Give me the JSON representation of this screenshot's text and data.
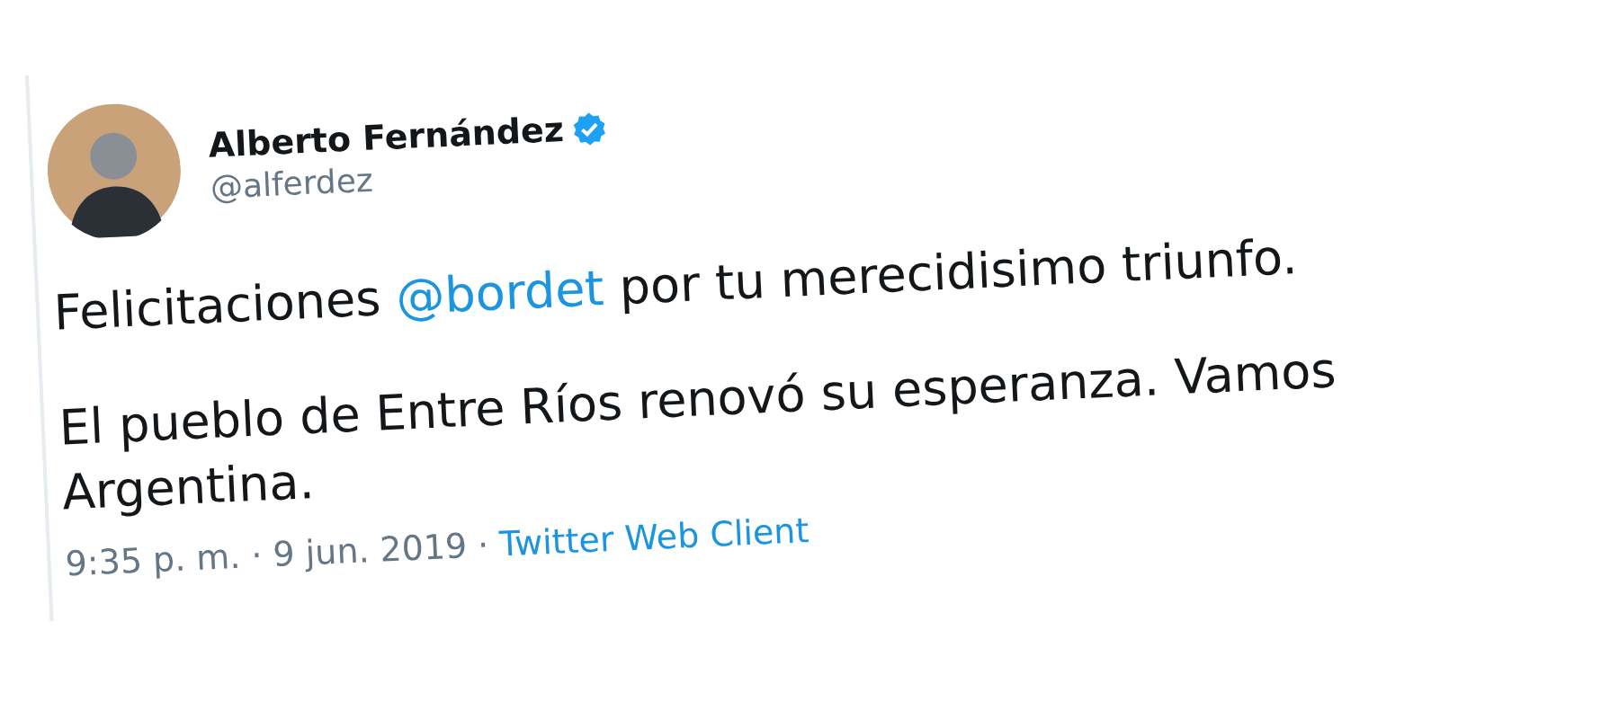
{
  "tweet": {
    "author": {
      "name": "Alberto Fernández",
      "verified": true,
      "handle": "@alferdez"
    },
    "paragraphs": [
      [
        {
          "kind": "text",
          "text": "Felicitaciones "
        },
        {
          "kind": "mention",
          "text": "@bordet"
        },
        {
          "kind": "text",
          "text": " por tu merecidisimo triunfo."
        }
      ],
      [
        {
          "kind": "text",
          "text": "El pueblo de Entre Ríos renovó su esperanza. Vamos Argentina."
        }
      ]
    ],
    "meta": {
      "timestamp": "9:35 p. m. · 9 jun. 2019",
      "separator": "·",
      "source": "Twitter Web Client"
    }
  }
}
